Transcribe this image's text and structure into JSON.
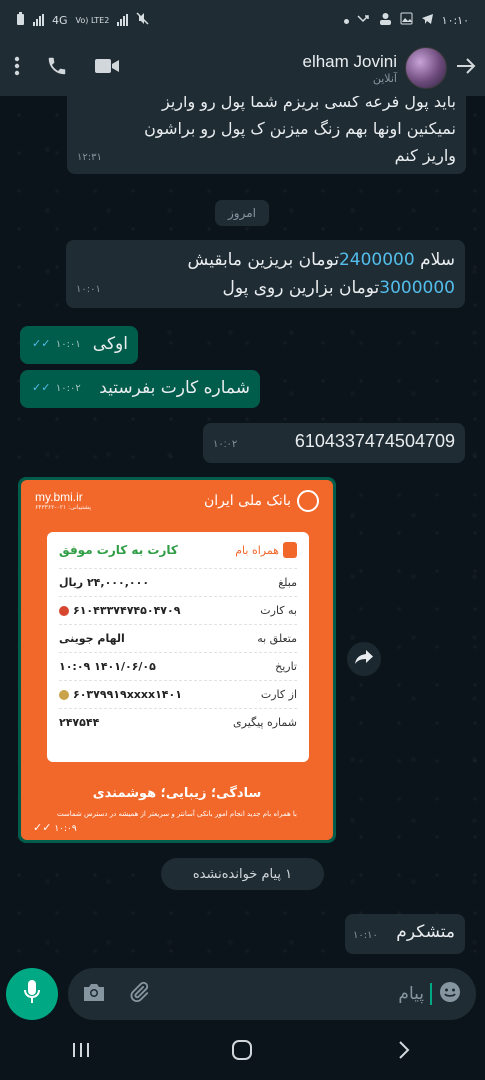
{
  "status_bar": {
    "left": {
      "network": "4G",
      "volte": "Vo) LTE2"
    },
    "time": "۱۰:۱۰"
  },
  "header": {
    "contact_name": "elham Jovini",
    "contact_status": "آنلاین"
  },
  "messages": [
    {
      "direction": "in",
      "text_lines": [
        "باید پول فرعه کسی بریزم شما پول رو واریز",
        "نمیکنین اونها بهم زنگ میزنن ک پول رو براشون",
        "واریز کنم"
      ],
      "time": "۱۲:۳۱"
    },
    {
      "direction": "in",
      "line1_pre": "سلام ",
      "line1_num": "2400000",
      "line1_post": "تومان بریزین مابقیش",
      "line2_num": "3000000",
      "line2_post": "تومان بزارین روی پول",
      "time": "۱۰:۰۱"
    },
    {
      "direction": "out",
      "text": "اوکی",
      "time": "۱۰:۰۱"
    },
    {
      "direction": "out",
      "text": "شماره کارت بفرستید",
      "time": "۱۰:۰۲"
    },
    {
      "direction": "in",
      "text": "6104337474504709",
      "time": "۱۰:۰۲"
    },
    {
      "direction": "out",
      "text": "متشکرم",
      "time": "۱۰:۱۰"
    }
  ],
  "date_chip": "امروز",
  "receipt": {
    "bank_name": "بانک ملی ایران",
    "site_url": "my.bmi.ir",
    "support": "پشتیبانی: ۰۲۱-۶۴۳۳۶۲",
    "app_name": "همراه بام",
    "success_title": "کارت به کارت موفق",
    "rows": [
      {
        "label": "مبلغ",
        "value": "۲۴,۰۰۰,۰۰۰ ریال"
      },
      {
        "label": "به کارت",
        "value": "۶۱۰۴۳۳۷۴۷۴۵۰۴۷۰۹"
      },
      {
        "label": "متعلق به",
        "value": "الهام جوینی"
      },
      {
        "label": "تاریخ",
        "value": "۱۴۰۱/۰۶/۰۵  ۱۰:۰۹"
      },
      {
        "label": "از کارت",
        "value": "۶۰۳۷۹۹۱۹xxxx۱۴۰۱"
      },
      {
        "label": "شماره پیگیری",
        "value": "۲۴۷۵۴۴"
      }
    ],
    "slogan": "سادگی؛ زیبایی؛ هوشمندی",
    "footer": "با همراه بام جدید انجام امور بانکی آسانتر و سریعتر از همیشه در دسترس شماست",
    "time": "۱۰:۰۹"
  },
  "unread_chip": "۱ پیام خوانده‌نشده",
  "input": {
    "placeholder": "پیام"
  },
  "colors": {
    "accent": "#00a884",
    "bubble_out": "#005c4b",
    "bubble_in": "#1f2c34",
    "link_blue": "#53bdeb",
    "receipt_orange": "#f2672a"
  },
  "icons": [
    "more-vert-icon",
    "call-icon",
    "video-call-icon",
    "back-arrow-icon",
    "forward-icon",
    "mic-icon",
    "camera-icon",
    "attach-icon",
    "emoji-icon",
    "recents-icon",
    "home-icon",
    "back-nav-icon"
  ]
}
